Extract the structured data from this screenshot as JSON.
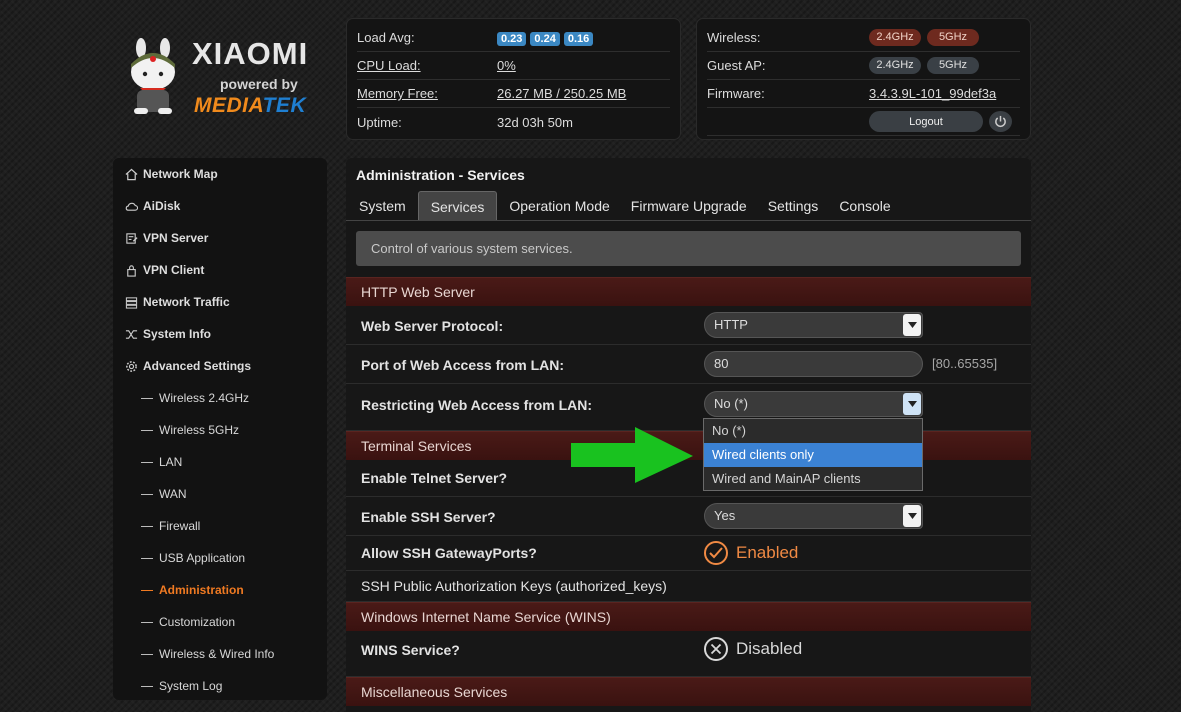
{
  "logo": {
    "brand": "XIAOMI",
    "powered_by": "powered by",
    "chip_part1": "MEDIA",
    "chip_part2": "TEK"
  },
  "status_left": {
    "load_avg": {
      "label": "Load Avg:",
      "values": [
        "0.23",
        "0.24",
        "0.16"
      ]
    },
    "cpu_load": {
      "label": "CPU Load:",
      "value": "0%"
    },
    "memory_free": {
      "label": "Memory Free:",
      "value": "26.27 MB / 250.25 MB"
    },
    "uptime": {
      "label": "Uptime:",
      "value": "32d 03h 50m"
    }
  },
  "status_right": {
    "wireless": {
      "label": "Wireless:",
      "band1": "2.4GHz",
      "band2": "5GHz"
    },
    "guest_ap": {
      "label": "Guest AP:",
      "band1": "2.4GHz",
      "band2": "5GHz"
    },
    "firmware": {
      "label": "Firmware:",
      "value": "3.4.3.9L-101_99def3a"
    },
    "logout_label": "Logout"
  },
  "sidebar": {
    "items": [
      {
        "label": "Network Map",
        "icon": "home-icon"
      },
      {
        "label": "AiDisk",
        "icon": "cloud-icon"
      },
      {
        "label": "VPN Server",
        "icon": "vpn-server-icon"
      },
      {
        "label": "VPN Client",
        "icon": "vpn-client-icon"
      },
      {
        "label": "Network Traffic",
        "icon": "traffic-icon"
      },
      {
        "label": "System Info",
        "icon": "shuffle-icon"
      },
      {
        "label": "Advanced Settings",
        "icon": "gear-icon"
      }
    ],
    "subitems": [
      "Wireless 2.4GHz",
      "Wireless 5GHz",
      "LAN",
      "WAN",
      "Firewall",
      "USB Application",
      "Administration",
      "Customization",
      "Wireless & Wired Info",
      "System Log"
    ],
    "active_subitem": "Administration"
  },
  "main": {
    "title": "Administration - Services",
    "tabs": [
      "System",
      "Services",
      "Operation Mode",
      "Firmware Upgrade",
      "Settings",
      "Console"
    ],
    "active_tab": "Services",
    "info": "Control of various system services.",
    "sections": {
      "http": "HTTP Web Server",
      "terminal": "Terminal Services",
      "wins": "Windows Internet Name Service (WINS)",
      "misc": "Miscellaneous Services"
    },
    "web_protocol": {
      "label": "Web Server Protocol:",
      "value": "HTTP"
    },
    "web_port": {
      "label": "Port of Web Access from LAN:",
      "value": "80",
      "hint": "[80..65535]"
    },
    "restrict_access": {
      "label": "Restricting Web Access from LAN:",
      "value": "No (*)",
      "options": [
        "No (*)",
        "Wired clients only",
        "Wired and MainAP clients"
      ],
      "highlighted": "Wired clients only"
    },
    "telnet": {
      "label": "Enable Telnet Server?"
    },
    "ssh": {
      "label": "Enable SSH Server?",
      "value": "Yes"
    },
    "ssh_gateway": {
      "label": "Allow SSH GatewayPorts?",
      "state": "Enabled"
    },
    "ssh_keys": {
      "label": "SSH Public Authorization Keys (authorized_keys)"
    },
    "wins_service": {
      "label": "WINS Service?",
      "state": "Disabled"
    }
  },
  "colors": {
    "accent_orange": "#f07a22",
    "section_red": "#4a1a17",
    "highlight_blue": "#3b82d4",
    "annotation_green": "#19c21f"
  }
}
